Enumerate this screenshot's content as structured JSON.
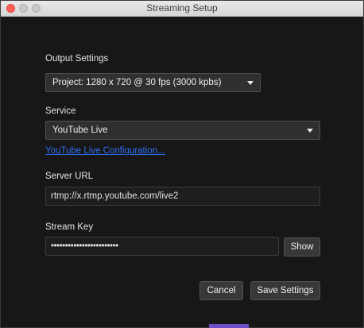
{
  "window": {
    "title": "Streaming Setup"
  },
  "output": {
    "label": "Output Settings",
    "selected": "Project: 1280 x 720 @ 30 fps (3000 kpbs)"
  },
  "service": {
    "label": "Service",
    "selected": "YouTube Live",
    "config_link": "YouTube Live Configuration..."
  },
  "server": {
    "label": "Server URL",
    "value": "rtmp://x.rtmp.youtube.com/live2"
  },
  "stream_key": {
    "label": "Stream Key",
    "value": "••••••••••••••••••••••••",
    "show_label": "Show"
  },
  "actions": {
    "cancel_label": "Cancel",
    "save_label": "Save Settings"
  }
}
